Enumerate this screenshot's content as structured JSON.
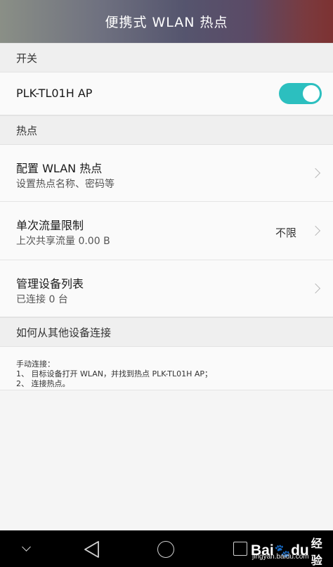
{
  "header": {
    "title": "便携式 WLAN 热点"
  },
  "sections": {
    "switch": "开关",
    "hotspot": "热点",
    "connect": "如何从其他设备连接"
  },
  "ap_row": {
    "label": "PLK-TL01H AP",
    "toggle_on": true
  },
  "configure_row": {
    "title": "配置 WLAN 热点",
    "subtitle": "设置热点名称、密码等"
  },
  "data_limit_row": {
    "title": "单次流量限制",
    "subtitle": "上次共享流量 0.00 B",
    "value": "不限"
  },
  "devices_row": {
    "title": "管理设备列表",
    "subtitle": "已连接 0 台"
  },
  "instructions": {
    "line1": "手动连接：",
    "line2": "1、 目标设备打开 WLAN，并找到热点 PLK-TL01H AP；",
    "line3": "2、 连接热点。"
  },
  "watermark": {
    "brand_bai": "Bai",
    "brand_du": "du",
    "brand_cn": "经验",
    "url": "jingyan.baidu.com"
  },
  "colors": {
    "toggle_accent": "#2cbfbf",
    "navbar": "#000000"
  }
}
